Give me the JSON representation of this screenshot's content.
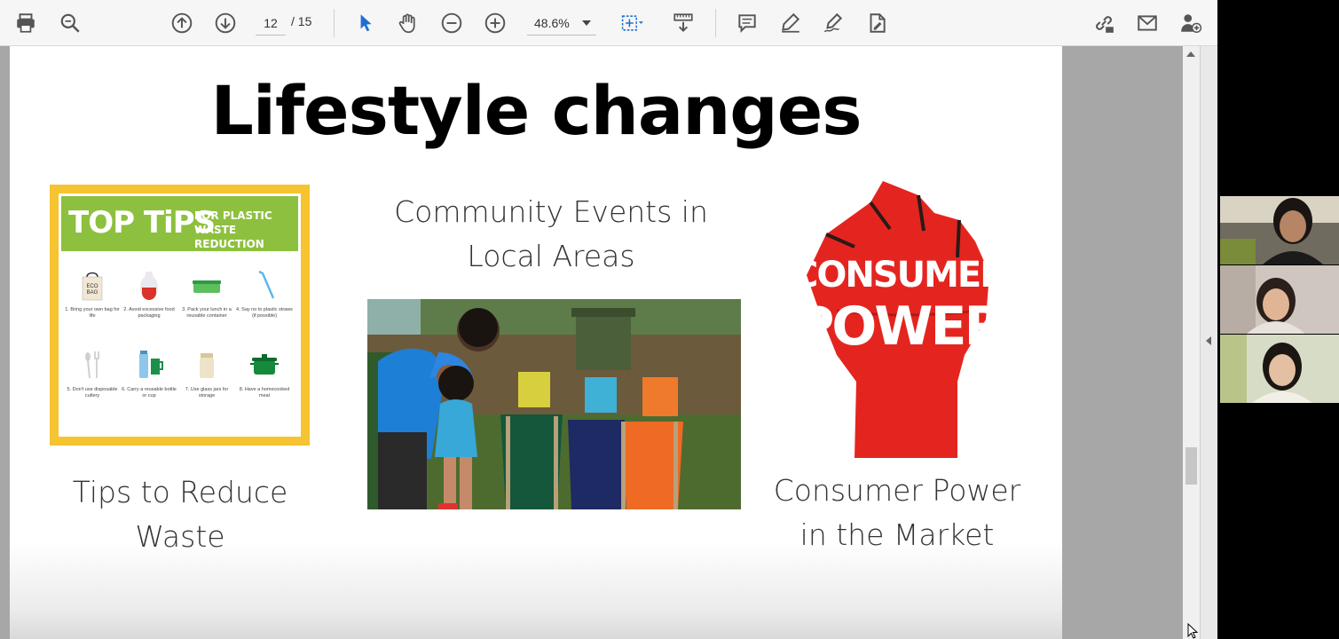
{
  "toolbar": {
    "current_page": "12",
    "total_pages": "/ 15",
    "zoom": "48.6%",
    "icons": [
      "print-icon",
      "search-icon",
      "page-up-icon",
      "page-down-icon",
      "select-cursor-icon",
      "hand-tool-icon",
      "zoom-out-icon",
      "zoom-in-icon",
      "fit-page-icon",
      "scroll-mode-icon",
      "comment-icon",
      "highlight-icon",
      "sign-icon",
      "edit-pdf-icon",
      "share-link-icon",
      "email-icon",
      "add-user-icon"
    ]
  },
  "slide": {
    "title": "Lifestyle changes",
    "caption_left_1": "Tips to Reduce",
    "caption_left_2": "Waste",
    "caption_middle_1": "Community Events in",
    "caption_middle_2": "Local Areas",
    "caption_right_1": "Consumer Power",
    "caption_right_2": "in the Market",
    "poster": {
      "title_big": "TOP TiPS",
      "title_small_1": "FOR PLASTIC",
      "title_small_2": "WASTE REDUCTION",
      "eco_bag_label": "ECO BAG",
      "tips": [
        "1. Bring your own bag for life",
        "2. Avoid excessive food packaging",
        "3. Pack your lunch in a reusable container",
        "4. Say no to plastic straws (if possible)",
        "5. Don't use disposable cutlery",
        "6. Carry a reusable bottle or cup",
        "7. Use glass jars for storage",
        "8. Have a homecooked meal"
      ]
    },
    "fist": {
      "line1": "CONSUMER",
      "line2": "POWER"
    }
  },
  "colors": {
    "poster_border": "#f6c331",
    "poster_green": "#8dc03e",
    "fist_red": "#e4251f"
  }
}
